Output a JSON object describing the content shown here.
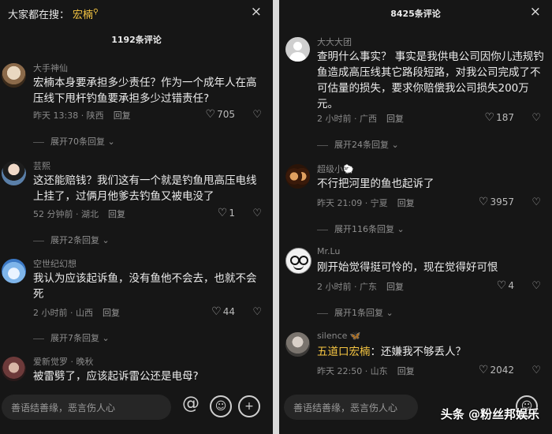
{
  "left": {
    "search_label": "大家都在搜：",
    "search_term": "宏楠",
    "search_icon": "search-icon",
    "close": "×",
    "comment_count": "1192条评论",
    "comments": [
      {
        "user": "大手神仙",
        "text": "宏楠本身要承担多少责任？作为一个成年人在高压线下甩杆钓鱼要承担多少过错责任?",
        "time": "昨天 13:38 · 陕西",
        "reply": "回复",
        "likes": "705",
        "expand": "展开70条回复"
      },
      {
        "user": "芸熙",
        "text": "这还能赔钱？我们这有一个就是钓鱼甩高压电线上挂了，过俩月他爹去钓鱼又被电没了",
        "time": "52 分钟前 · 湖北",
        "reply": "回复",
        "likes": "1",
        "expand": "展开2条回复"
      },
      {
        "user": "空世纪幻想",
        "text": "我认为应该起诉鱼，没有鱼他不会去，也就不会死",
        "time": "2 小时前 · 山西",
        "reply": "回复",
        "likes": "44",
        "expand": "展开7条回复"
      },
      {
        "user": "爱新觉罗 · 晚秋",
        "text": "被雷劈了，应该起诉雷公还是电母?"
      }
    ],
    "input_placeholder": "善语结善缘，恶言伤人心"
  },
  "right": {
    "close": "×",
    "comment_count": "8425条评论",
    "comments": [
      {
        "user": "大大大团",
        "text": "查明什么事实？ 事实是我供电公司因你儿违规钓鱼造成高压线其它路段短路，对我公司完成了不可估量的损失，要求你赔偿我公司损失200万元。",
        "time": "2 小时前 · 广西",
        "reply": "回复",
        "likes": "187",
        "expand": "展开24条回复"
      },
      {
        "user": "超级小🐑",
        "text": "不行把河里的鱼也起诉了",
        "time": "昨天 21:09 · 宁夏",
        "reply": "回复",
        "likes": "3957",
        "expand": "展开116条回复"
      },
      {
        "user": "Mr.Lu",
        "text": "刚开始觉得挺可怜的，现在觉得好可恨",
        "time": "2 小时前 · 广东",
        "reply": "回复",
        "likes": "4",
        "expand": "展开1条回复"
      },
      {
        "user": "silence 🦋",
        "text_highlight": "五道口宏楠",
        "text": "：还嫌我不够丢人？",
        "time": "昨天 22:50 · 山东",
        "reply": "回复",
        "likes": "2042"
      }
    ],
    "input_placeholder": "善语结善缘，恶言伤人心"
  },
  "icons": {
    "heart": "♡",
    "dislike": "💔",
    "chevron": "⌄",
    "at": "@",
    "emoji": "☺",
    "plus": "+"
  },
  "watermark": "头条 @粉丝邦娱乐"
}
